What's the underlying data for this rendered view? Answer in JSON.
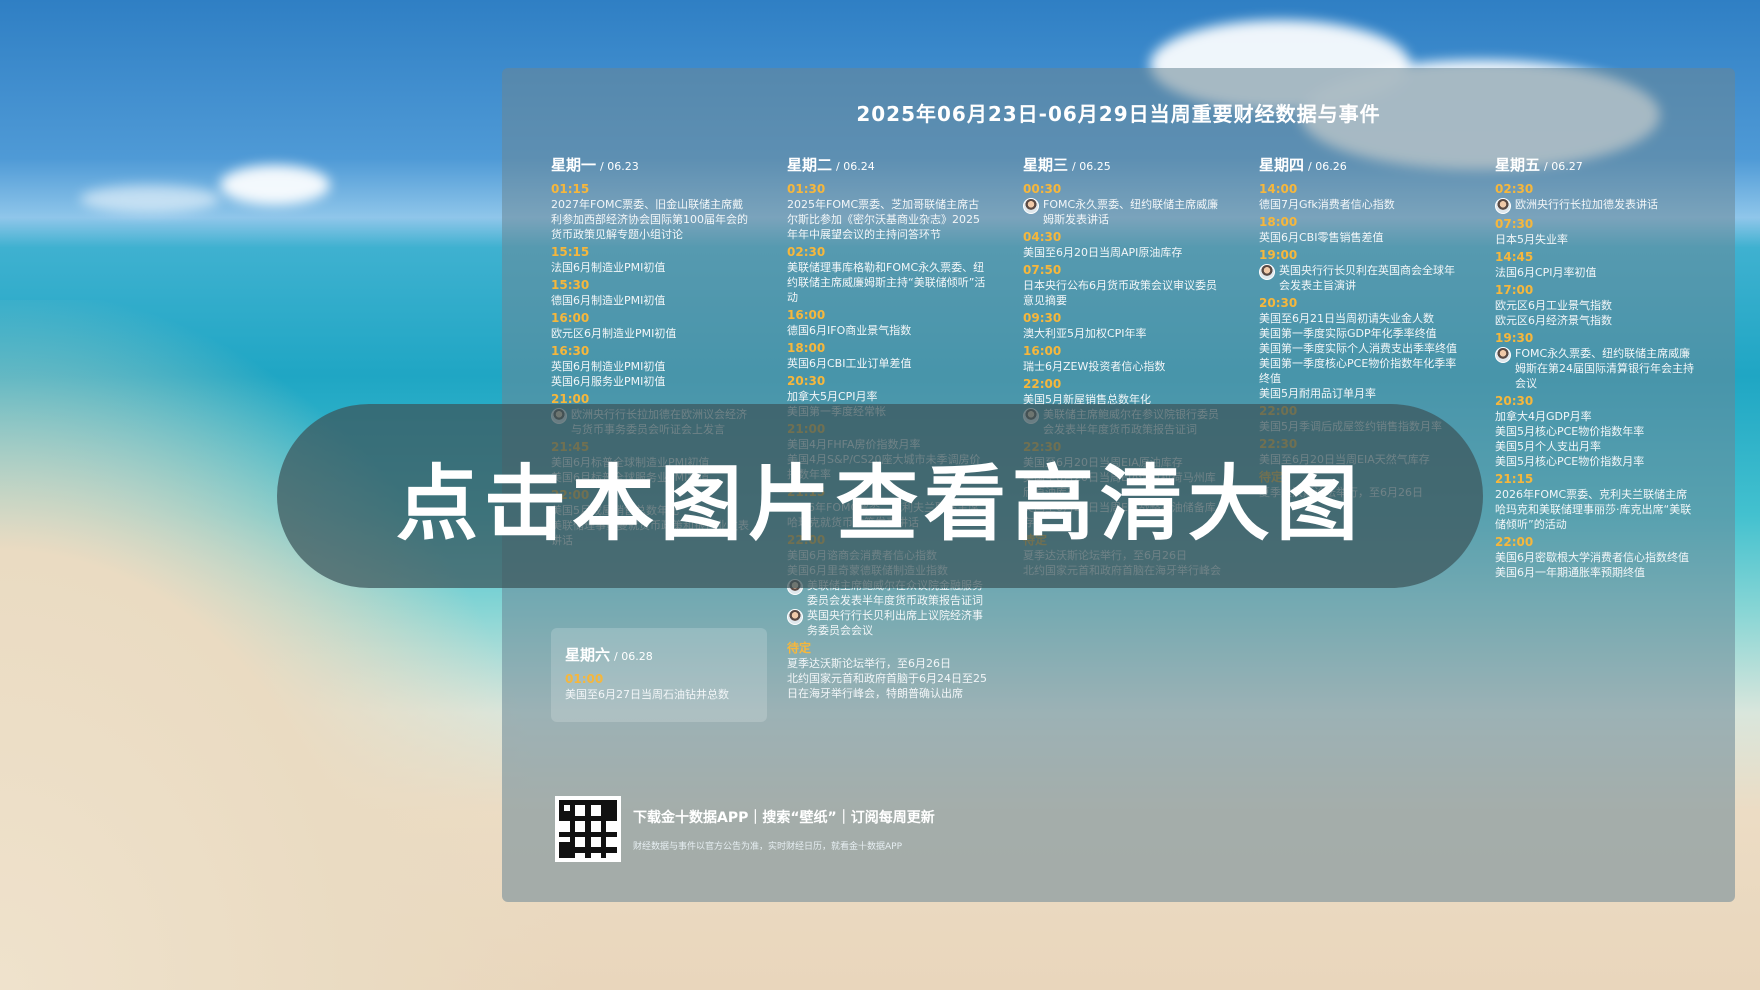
{
  "title": "2025年06月23日-06月29日当周重要财经数据与事件",
  "days": [
    {
      "name": "星期一",
      "date": "/ 06.23",
      "items": [
        {
          "time": "01:15",
          "events": [
            {
              "text": "2027年FOMC票委、旧金山联储主席戴利参加西部经济协会国际第100届年会的货币政策见解专题小组讨论",
              "avatar": false
            }
          ]
        },
        {
          "time": "15:15",
          "events": [
            {
              "text": "法国6月制造业PMI初值",
              "avatar": false
            }
          ]
        },
        {
          "time": "15:30",
          "events": [
            {
              "text": "德国6月制造业PMI初值",
              "avatar": false
            }
          ]
        },
        {
          "time": "16:00",
          "events": [
            {
              "text": "欧元区6月制造业PMI初值",
              "avatar": false
            }
          ]
        },
        {
          "time": "16:30",
          "events": [
            {
              "text": "英国6月制造业PMI初值",
              "avatar": false
            },
            {
              "text": "英国6月服务业PMI初值",
              "avatar": false
            }
          ]
        },
        {
          "time": "21:00",
          "events": [
            {
              "text": "欧洲央行行长拉加德在欧洲议会经济与货币事务委员会听证会上发言",
              "avatar": true
            }
          ]
        },
        {
          "time": "21:45",
          "events": [
            {
              "text": "美国6月标普全球制造业PMI初值",
              "avatar": false
            },
            {
              "text": "美国6月标普全球服务业PMI初值",
              "avatar": false
            }
          ]
        },
        {
          "time": "22:00",
          "events": [
            {
              "text": "美国5月成屋销售总数年化",
              "avatar": false
            },
            {
              "text": "美联储理事鲍曼就货币政策和银行业发表讲话",
              "avatar": false
            }
          ]
        }
      ]
    },
    {
      "name": "星期二",
      "date": "/ 06.24",
      "items": [
        {
          "time": "01:30",
          "events": [
            {
              "text": "2025年FOMC票委、芝加哥联储主席古尔斯比参加《密尔沃基商业杂志》2025年年中展望会议的主持问答环节",
              "avatar": false
            }
          ]
        },
        {
          "time": "02:30",
          "events": [
            {
              "text": "美联储理事库格勒和FOMC永久票委、纽约联储主席威廉姆斯主持“美联储倾听”活动",
              "avatar": false
            }
          ]
        },
        {
          "time": "16:00",
          "events": [
            {
              "text": "德国6月IFO商业景气指数",
              "avatar": false
            }
          ]
        },
        {
          "time": "18:00",
          "events": [
            {
              "text": "英国6月CBI工业订单差值",
              "avatar": false
            }
          ]
        },
        {
          "time": "20:30",
          "events": [
            {
              "text": "加拿大5月CPI月率",
              "avatar": false
            },
            {
              "text": "美国第一季度经常帐",
              "avatar": false
            }
          ]
        },
        {
          "time": "21:00",
          "events": [
            {
              "text": "美国4月FHFA房价指数月率",
              "avatar": false
            },
            {
              "text": "美国4月S&P/CS20座大城市未季调房价指数年率",
              "avatar": false
            }
          ]
        },
        {
          "time": "21:15",
          "events": [
            {
              "text": "2026年FOMC票委、克利夫兰联储主席哈玛克就货币政策发表讲话",
              "avatar": false
            }
          ]
        },
        {
          "time": "22:00",
          "events": [
            {
              "text": "美国6月谘商会消费者信心指数",
              "avatar": false
            },
            {
              "text": "美国6月里奇蒙德联储制造业指数",
              "avatar": false
            },
            {
              "text": "美联储主席鲍威尔在众议院金融服务委员会发表半年度货币政策报告证词",
              "avatar": true
            },
            {
              "text": "英国央行行长贝利出席上议院经济事务委员会会议",
              "avatar": true
            }
          ]
        },
        {
          "time": "待定",
          "events": [
            {
              "text": "夏季达沃斯论坛举行，至6月26日",
              "avatar": false
            },
            {
              "text": "北约国家元首和政府首脑于6月24日至25日在海牙举行峰会，特朗普确认出席",
              "avatar": false
            }
          ]
        }
      ]
    },
    {
      "name": "星期三",
      "date": "/ 06.25",
      "items": [
        {
          "time": "00:30",
          "events": [
            {
              "text": "FOMC永久票委、纽约联储主席威廉姆斯发表讲话",
              "avatar": true
            }
          ]
        },
        {
          "time": "04:30",
          "events": [
            {
              "text": "美国至6月20日当周API原油库存",
              "avatar": false
            }
          ]
        },
        {
          "time": "07:50",
          "events": [
            {
              "text": "日本央行公布6月货币政策会议审议委员意见摘要",
              "avatar": false
            }
          ]
        },
        {
          "time": "09:30",
          "events": [
            {
              "text": "澳大利亚5月加权CPI年率",
              "avatar": false
            }
          ]
        },
        {
          "time": "16:00",
          "events": [
            {
              "text": "瑞士6月ZEW投资者信心指数",
              "avatar": false
            }
          ]
        },
        {
          "time": "22:00",
          "events": [
            {
              "text": "美国5月新屋销售总数年化",
              "avatar": false
            },
            {
              "text": "美联储主席鲍威尔在参议院银行委员会发表半年度货币政策报告证词",
              "avatar": true
            }
          ]
        },
        {
          "time": "22:30",
          "events": [
            {
              "text": "美国至6月20日当周EIA原油库存",
              "avatar": false
            },
            {
              "text": "美国至6月20日当周EIA俄克拉荷马州库欣原油库存",
              "avatar": false
            },
            {
              "text": "美国至6月20日当周EIA战略石油储备库存",
              "avatar": false
            }
          ]
        },
        {
          "time": "待定",
          "events": [
            {
              "text": "夏季达沃斯论坛举行，至6月26日",
              "avatar": false
            },
            {
              "text": "北约国家元首和政府首脑在海牙举行峰会",
              "avatar": false
            }
          ]
        }
      ]
    },
    {
      "name": "星期四",
      "date": "/ 06.26",
      "items": [
        {
          "time": "14:00",
          "events": [
            {
              "text": "德国7月Gfk消费者信心指数",
              "avatar": false
            }
          ]
        },
        {
          "time": "18:00",
          "events": [
            {
              "text": "英国6月CBI零售销售差值",
              "avatar": false
            }
          ]
        },
        {
          "time": "19:00",
          "events": [
            {
              "text": "英国央行行长贝利在英国商会全球年会发表主旨演讲",
              "avatar": true
            }
          ]
        },
        {
          "time": "20:30",
          "events": [
            {
              "text": "美国至6月21日当周初请失业金人数",
              "avatar": false
            },
            {
              "text": "美国第一季度实际GDP年化季率终值",
              "avatar": false
            },
            {
              "text": "美国第一季度实际个人消费支出季率终值",
              "avatar": false
            },
            {
              "text": "美国第一季度核心PCE物价指数年化季率终值",
              "avatar": false
            },
            {
              "text": "美国5月耐用品订单月率",
              "avatar": false
            }
          ]
        },
        {
          "time": "22:00",
          "events": [
            {
              "text": "美国5月季调后成屋签约销售指数月率",
              "avatar": false
            }
          ]
        },
        {
          "time": "22:30",
          "events": [
            {
              "text": "美国至6月20日当周EIA天然气库存",
              "avatar": false
            }
          ]
        },
        {
          "time": "待定",
          "events": [
            {
              "text": "夏季达沃斯论坛举行，至6月26日",
              "avatar": false
            }
          ]
        }
      ]
    },
    {
      "name": "星期五",
      "date": "/ 06.27",
      "items": [
        {
          "time": "02:30",
          "events": [
            {
              "text": "欧洲央行行长拉加德发表讲话",
              "avatar": true
            }
          ]
        },
        {
          "time": "07:30",
          "events": [
            {
              "text": "日本5月失业率",
              "avatar": false
            }
          ]
        },
        {
          "time": "14:45",
          "events": [
            {
              "text": "法国6月CPI月率初值",
              "avatar": false
            }
          ]
        },
        {
          "time": "17:00",
          "events": [
            {
              "text": "欧元区6月工业景气指数",
              "avatar": false
            },
            {
              "text": "欧元区6月经济景气指数",
              "avatar": false
            }
          ]
        },
        {
          "time": "19:30",
          "events": [
            {
              "text": "FOMC永久票委、纽约联储主席威廉姆斯在第24届国际清算银行年会主持会议",
              "avatar": true
            }
          ]
        },
        {
          "time": "20:30",
          "events": [
            {
              "text": "加拿大4月GDP月率",
              "avatar": false
            },
            {
              "text": "美国5月核心PCE物价指数年率",
              "avatar": false
            },
            {
              "text": "美国5月个人支出月率",
              "avatar": false
            },
            {
              "text": "美国5月核心PCE物价指数月率",
              "avatar": false
            }
          ]
        },
        {
          "time": "21:15",
          "events": [
            {
              "text": "2026年FOMC票委、克利夫兰联储主席哈玛克和美联储理事丽莎·库克出席“美联储倾听”的活动",
              "avatar": false
            }
          ]
        },
        {
          "time": "22:00",
          "events": [
            {
              "text": "美国6月密歇根大学消费者信心指数终值",
              "avatar": false
            },
            {
              "text": "美国6月一年期通胀率预期终值",
              "avatar": false
            }
          ]
        }
      ]
    }
  ],
  "saturday": {
    "name": "星期六",
    "date": "/ 06.28",
    "time": "01:00",
    "event": "美国至6月27日当周石油钻井总数"
  },
  "footer": {
    "main": "下载金十数据APP｜搜索“壁纸”｜订阅每周更新",
    "sub": "财经数据与事件以官方公告为准，实时财经日历，就看金十数据APP"
  },
  "overlay_text": "点击本图片查看高清大图"
}
